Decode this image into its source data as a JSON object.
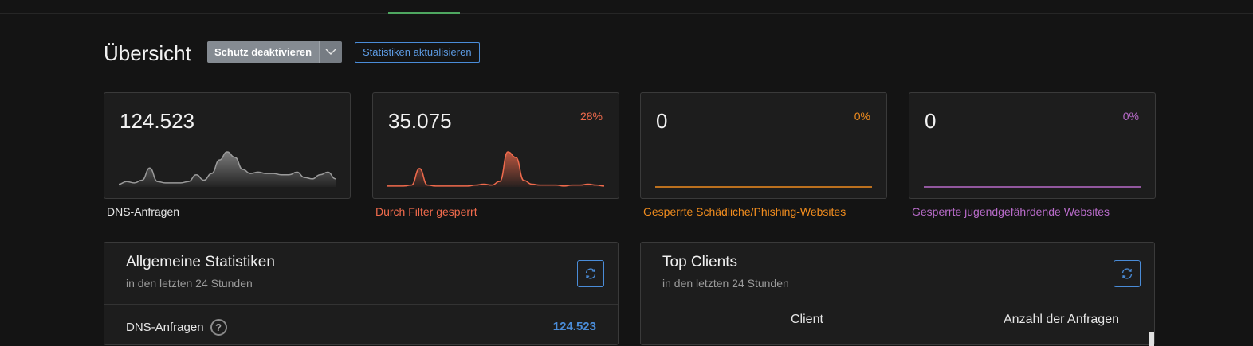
{
  "header": {
    "title": "Übersicht",
    "protection_button": "Schutz deaktivieren",
    "refresh_stats_button": "Statistiken aktualisieren"
  },
  "stats": [
    {
      "value": "124.523",
      "percent": "",
      "label": "DNS-Anfragen",
      "color": "#9a9a9a",
      "series": [
        2,
        4,
        3,
        5,
        14,
        4,
        3,
        3,
        3,
        4,
        9,
        5,
        10,
        20,
        26,
        22,
        13,
        10,
        11,
        10,
        10,
        9,
        9,
        11,
        7,
        6,
        9,
        11,
        6
      ]
    },
    {
      "value": "35.075",
      "percent": "28%",
      "label": "Durch Filter gesperrt",
      "color": "#ef6a4c",
      "series": [
        1,
        1,
        1,
        2,
        20,
        2,
        1,
        1,
        1,
        1,
        1,
        2,
        3,
        2,
        6,
        38,
        32,
        7,
        3,
        2,
        2,
        2,
        1,
        2,
        2,
        3,
        2,
        1
      ]
    },
    {
      "value": "0",
      "percent": "0%",
      "label": "Gesperrte Schädliche/Phishing-Websites",
      "color": "#f08c1e",
      "series": [
        0,
        0,
        0,
        0,
        0,
        0,
        0,
        0,
        0,
        0,
        0,
        0
      ]
    },
    {
      "value": "0",
      "percent": "0%",
      "label": "Gesperrte jugendgefährdende Websites",
      "color": "#b86bc9",
      "series": [
        0,
        0,
        0,
        0,
        0,
        0,
        0,
        0,
        0,
        0,
        0,
        0
      ]
    }
  ],
  "general_stats": {
    "title": "Allgemeine Statistiken",
    "subtitle": "in den letzten 24 Stunden",
    "rows": [
      {
        "label": "DNS-Anfragen",
        "value": "124.523"
      }
    ]
  },
  "top_clients": {
    "title": "Top Clients",
    "subtitle": "in den letzten 24 Stunden",
    "columns": [
      "Client",
      "Anzahl der Anfragen"
    ]
  },
  "colors": {
    "accent": "#4a8cd8",
    "active_tab": "#4ea760",
    "dns": "#9a9a9a",
    "blocked": "#ef6a4c",
    "malware": "#f08c1e",
    "adult": "#b86bc9"
  },
  "icons": {
    "dropdown": "chevron-down-icon",
    "refresh": "refresh-icon",
    "help": "help-icon"
  }
}
